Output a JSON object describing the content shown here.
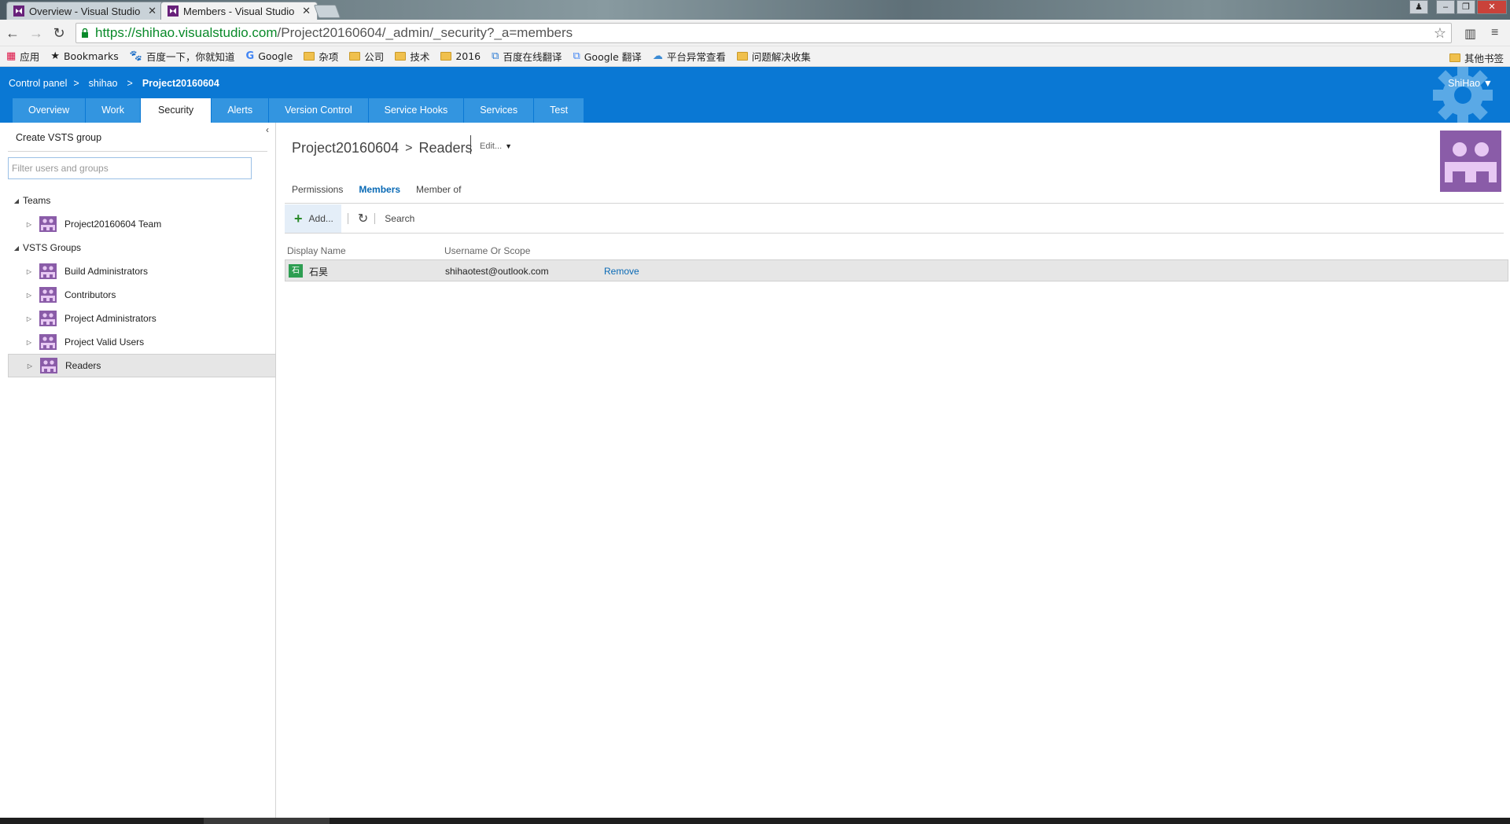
{
  "browser": {
    "tabs": [
      {
        "title": "Overview - Visual Studio"
      },
      {
        "title": "Members - Visual Studio"
      }
    ],
    "url_host": "https://shihao.visualstudio.com",
    "url_path": "/Project20160604/_admin/_security?_a=members",
    "bookmarks": [
      {
        "label": "应用",
        "icon": "apps-grid-icon"
      },
      {
        "label": "Bookmarks",
        "icon": "star-icon"
      },
      {
        "label": "百度一下，你就知道",
        "icon": "baidu-icon"
      },
      {
        "label": "Google",
        "icon": "google-icon"
      },
      {
        "label": "杂项",
        "icon": "folder-icon"
      },
      {
        "label": "公司",
        "icon": "folder-icon"
      },
      {
        "label": "技术",
        "icon": "folder-icon"
      },
      {
        "label": "2016",
        "icon": "folder-icon"
      },
      {
        "label": "百度在线翻译",
        "icon": "translate-icon"
      },
      {
        "label": "Google 翻译",
        "icon": "translate-icon"
      },
      {
        "label": "平台异常查看",
        "icon": "platform-icon"
      },
      {
        "label": "问题解决收集",
        "icon": "folder-icon"
      }
    ],
    "other_bookmarks": "其他书签"
  },
  "header": {
    "breadcrumb": [
      "Control panel",
      "shihao",
      "Project20160604"
    ],
    "user": "ShiHao",
    "nav_tabs": [
      "Overview",
      "Work",
      "Security",
      "Alerts",
      "Version Control",
      "Service Hooks",
      "Services",
      "Test"
    ],
    "active_tab": "Security",
    "brand_color": "#0a78d4"
  },
  "sidebar": {
    "create_group": "Create VSTS group",
    "filter_placeholder": "Filter users and groups",
    "teams_label": "Teams",
    "teams": [
      "Project20160604 Team"
    ],
    "groups_label": "VSTS Groups",
    "groups": [
      "Build Administrators",
      "Contributors",
      "Project Administrators",
      "Project Valid Users",
      "Readers"
    ],
    "selected": "Readers"
  },
  "main": {
    "title_project": "Project20160604",
    "title_sep": ">",
    "title_group": "Readers",
    "edit_label": "Edit...",
    "subtabs": [
      "Permissions",
      "Members",
      "Member of"
    ],
    "active_subtab": "Members",
    "toolbar": {
      "add_label": "Add...",
      "search_label": "Search"
    },
    "columns": [
      "Display Name",
      "Username Or Scope"
    ],
    "members": [
      {
        "avatar": "石",
        "display_name": "石昊",
        "username": "shihaotest@outlook.com",
        "action": "Remove"
      }
    ]
  }
}
